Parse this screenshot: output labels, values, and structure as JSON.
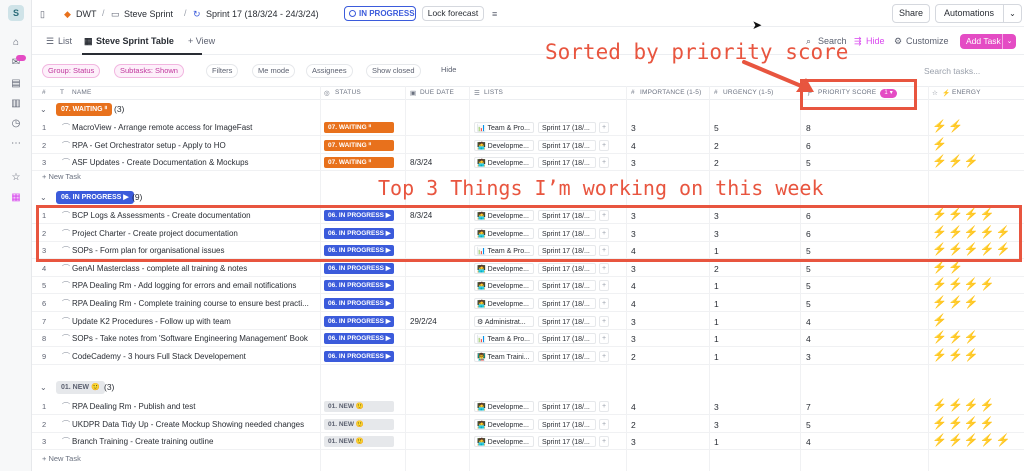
{
  "workspace_initial": "S",
  "breadcrumb": {
    "space": "DWT",
    "folder": "Steve Sprint",
    "sprint": "Sprint 17 (18/3/24 - 24/3/24)",
    "status": "IN PROGRESS",
    "lock_label": "Lock forecast"
  },
  "topbar": {
    "share": "Share",
    "automations": "Automations"
  },
  "views": {
    "list": "List",
    "table": "Steve Sprint Table",
    "add_view": "+ View",
    "search": "Search",
    "hide": "Hide",
    "customize": "Customize",
    "add_task": "Add Task"
  },
  "filters": {
    "group": "Group: Status",
    "subtasks": "Subtasks: Shown",
    "filters": "Filters",
    "me_mode": "Me mode",
    "assignees": "Assignees",
    "show_closed": "Show closed",
    "hide": "Hide",
    "search_placeholder": "Search tasks..."
  },
  "columns": {
    "hash": "#",
    "name": "NAME",
    "status": "STATUS",
    "due": "DUE DATE",
    "lists": "LISTS",
    "importance": "IMPORTANCE (1-5)",
    "urgency": "URGENCY (1-5)",
    "priority": "PRIORITY SCORE",
    "priority_pill": "1 ▾",
    "energy": "ENERGY"
  },
  "new_task_label": "+ New Task",
  "groups": {
    "waiting": {
      "label": "07. WAITING ᑊᑊ",
      "count": "(3)",
      "color": "#e8711c",
      "rows": [
        {
          "n": "1",
          "name": "MacroView - Arrange remote access for ImageFast",
          "status": "07. WAITING ᑊᑊ",
          "due": "",
          "list1": "📊 Team & Pro...",
          "list2": "Sprint 17 (18/...",
          "imp": "3",
          "urg": "5",
          "pri": "8",
          "energy": "⚡⚡"
        },
        {
          "n": "2",
          "name": "RPA - Get Orchestrator setup - Apply to HO",
          "status": "07. WAITING ᑊᑊ",
          "due": "",
          "list1": "🧑‍💻 Developme...",
          "list2": "Sprint 17 (18/...",
          "imp": "4",
          "urg": "2",
          "pri": "6",
          "energy": "⚡"
        },
        {
          "n": "3",
          "name": "ASF Updates - Create Documentation & Mockups",
          "status": "07. WAITING ᑊᑊ",
          "due": "8/3/24",
          "list1": "🧑‍💻 Developme...",
          "list2": "Sprint 17 (18/...",
          "imp": "3",
          "urg": "2",
          "pri": "5",
          "energy": "⚡⚡⚡"
        }
      ]
    },
    "inprogress": {
      "label": "06. IN PROGRESS ▶",
      "count": "(9)",
      "color": "#3b5bdb",
      "rows": [
        {
          "n": "1",
          "name": "BCP Logs & Assessments - Create documentation",
          "status": "06. IN PROGRESS ▶",
          "due": "8/3/24",
          "list1": "🧑‍💻 Developme...",
          "list2": "Sprint 17 (18/...",
          "imp": "3",
          "urg": "3",
          "pri": "6",
          "energy": "⚡⚡⚡⚡"
        },
        {
          "n": "2",
          "name": "Project Charter - Create project documentation",
          "status": "06. IN PROGRESS ▶",
          "due": "",
          "list1": "🧑‍💻 Developme...",
          "list2": "Sprint 17 (18/...",
          "imp": "3",
          "urg": "3",
          "pri": "6",
          "energy": "⚡⚡⚡⚡⚡"
        },
        {
          "n": "3",
          "name": "SOPs - Form plan for organisational issues",
          "status": "06. IN PROGRESS ▶",
          "due": "",
          "list1": "📊 Team & Pro...",
          "list2": "Sprint 17 (18/...",
          "imp": "4",
          "urg": "1",
          "pri": "5",
          "energy": "⚡⚡⚡⚡⚡"
        },
        {
          "n": "4",
          "name": "GenAI Masterclass - complete all training & notes",
          "status": "06. IN PROGRESS ▶",
          "due": "",
          "list1": "🧑‍💻 Developme...",
          "list2": "Sprint 17 (18/...",
          "imp": "3",
          "urg": "2",
          "pri": "5",
          "energy": "⚡⚡"
        },
        {
          "n": "5",
          "name": "RPA Dealing Rm - Add logging for errors and email notifications",
          "status": "06. IN PROGRESS ▶",
          "due": "",
          "list1": "🧑‍💻 Developme...",
          "list2": "Sprint 17 (18/...",
          "imp": "4",
          "urg": "1",
          "pri": "5",
          "energy": "⚡⚡⚡⚡"
        },
        {
          "n": "6",
          "name": "RPA Dealing Rm - Complete training course to ensure best practi...",
          "status": "06. IN PROGRESS ▶",
          "due": "",
          "list1": "🧑‍💻 Developme...",
          "list2": "Sprint 17 (18/...",
          "imp": "4",
          "urg": "1",
          "pri": "5",
          "energy": "⚡⚡⚡"
        },
        {
          "n": "7",
          "name": "Update K2 Procedures - Follow up with team",
          "status": "06. IN PROGRESS ▶",
          "due": "29/2/24",
          "list1": "⚙ Administrat...",
          "list2": "Sprint 17 (18/...",
          "imp": "3",
          "urg": "1",
          "pri": "4",
          "energy": "⚡"
        },
        {
          "n": "8",
          "name": "SOPs - Take notes from 'Software Engineering Management' Book",
          "status": "06. IN PROGRESS ▶",
          "due": "",
          "list1": "📊 Team & Pro...",
          "list2": "Sprint 17 (18/...",
          "imp": "3",
          "urg": "1",
          "pri": "4",
          "energy": "⚡⚡⚡"
        },
        {
          "n": "9",
          "name": "CodeCademy - 3 hours Full Stack Developement",
          "status": "06. IN PROGRESS ▶",
          "due": "",
          "list1": "👨‍🏫 Team Traini...",
          "list2": "Sprint 17 (18/...",
          "imp": "2",
          "urg": "1",
          "pri": "3",
          "energy": "⚡⚡⚡"
        }
      ]
    },
    "new": {
      "label": "01. NEW 🙂",
      "count": "(3)",
      "color": "#e6e8eb",
      "rows": [
        {
          "n": "1",
          "name": "RPA Dealing Rm - Publish and test",
          "status": "01. NEW 🙂",
          "due": "",
          "list1": "🧑‍💻 Developme...",
          "list2": "Sprint 17 (18/...",
          "imp": "4",
          "urg": "3",
          "pri": "7",
          "energy": "⚡⚡⚡⚡"
        },
        {
          "n": "2",
          "name": "UKDPR Data Tidy Up - Create Mockup Showing needed changes",
          "status": "01. NEW 🙂",
          "due": "",
          "list1": "🧑‍💻 Developme...",
          "list2": "Sprint 17 (18/...",
          "imp": "2",
          "urg": "3",
          "pri": "5",
          "energy": "⚡⚡⚡⚡"
        },
        {
          "n": "3",
          "name": "Branch Training - Create training outline",
          "status": "01. NEW 🙂",
          "due": "",
          "list1": "🧑‍💻 Developme...",
          "list2": "Sprint 17 (18/...",
          "imp": "3",
          "urg": "1",
          "pri": "4",
          "energy": "⚡⚡⚡⚡⚡"
        }
      ]
    }
  },
  "annotations": {
    "sorted": "Sorted by priority score",
    "top3": "Top 3 Things I’m working on this week",
    "color": "#e8553f"
  }
}
